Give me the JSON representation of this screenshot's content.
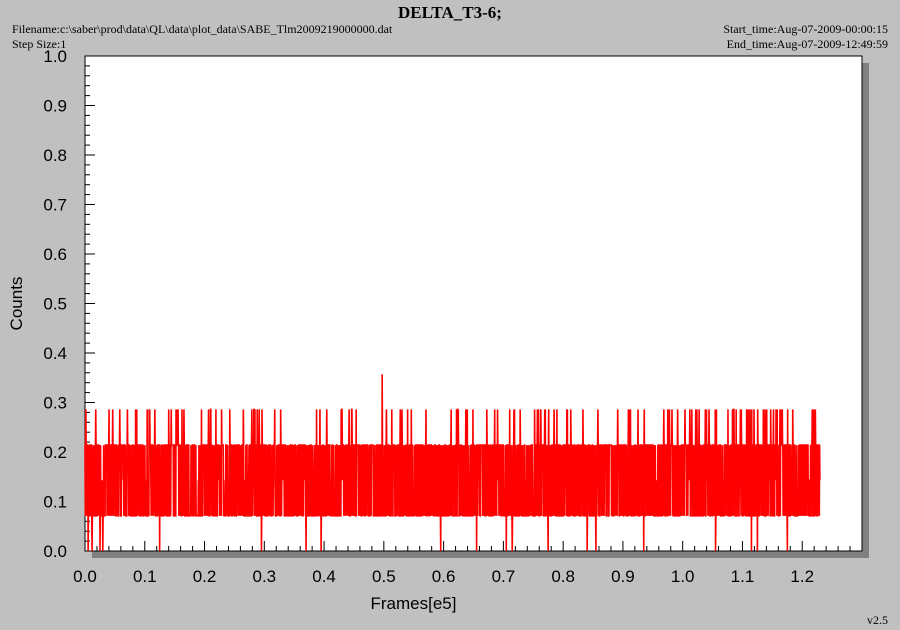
{
  "header": {
    "title": "DELTA_T3-6;",
    "filename": "Filename:c:\\saber\\prod\\data\\QL\\data\\plot_data\\SABE_Tlm2009219000000.dat",
    "step_size": "Step Size:1",
    "start_time": "Start_time:Aug-07-2009-00:00:15",
    "end_time": "End_time:Aug-07-2009-12:49:59",
    "version": "v2.5"
  },
  "colors": {
    "background": "#c0c0c0",
    "plot_area": "#ffffff",
    "series": "#ff0000",
    "shadow": "#808080"
  },
  "chart_data": {
    "type": "line",
    "title": "DELTA_T3-6;",
    "xlabel": "Frames[e5]",
    "ylabel": "Counts",
    "xlim": [
      0,
      1.3
    ],
    "ylim": [
      0,
      1.0
    ],
    "x_ticks": [
      "0.0",
      "0.1",
      "0.2",
      "0.3",
      "0.4",
      "0.5",
      "0.6",
      "0.7",
      "0.8",
      "0.9",
      "1.0",
      "1.1",
      "1.2"
    ],
    "y_ticks": [
      "0.0",
      "0.1",
      "0.2",
      "0.3",
      "0.4",
      "0.5",
      "0.6",
      "0.7",
      "0.8",
      "0.9",
      "1.0"
    ],
    "grid": false,
    "series": [
      {
        "x_range": [
          0,
          1.23
        ],
        "levels": [
          0.0,
          0.071,
          0.143,
          0.214,
          0.286,
          0.357
        ],
        "band_low": 0.071,
        "band_high": 0.214,
        "spike_max": 0.286,
        "peak": {
          "x": 0.497,
          "y": 0.357
        },
        "drops_to_zero_x": [
          0.005,
          0.012,
          0.025,
          0.03,
          0.125,
          0.295,
          0.37,
          0.395,
          0.595,
          0.655,
          0.705,
          0.715,
          0.775,
          0.84,
          0.855,
          0.935,
          1.055,
          1.115,
          1.125,
          1.175
        ],
        "end_value": 0.143
      }
    ]
  }
}
